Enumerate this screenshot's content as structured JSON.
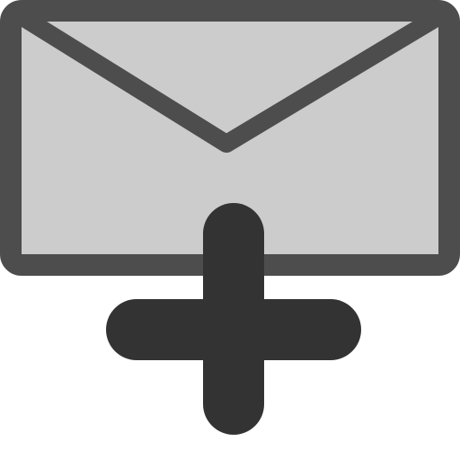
{
  "icon": {
    "name": "mail-new-icon",
    "parts": [
      "envelope-icon",
      "plus-icon"
    ]
  },
  "colors": {
    "background": "#ffffff",
    "envelope_fill": "#cccccc",
    "envelope_stroke": "#4d4d4d",
    "plus_fill": "#333333"
  }
}
